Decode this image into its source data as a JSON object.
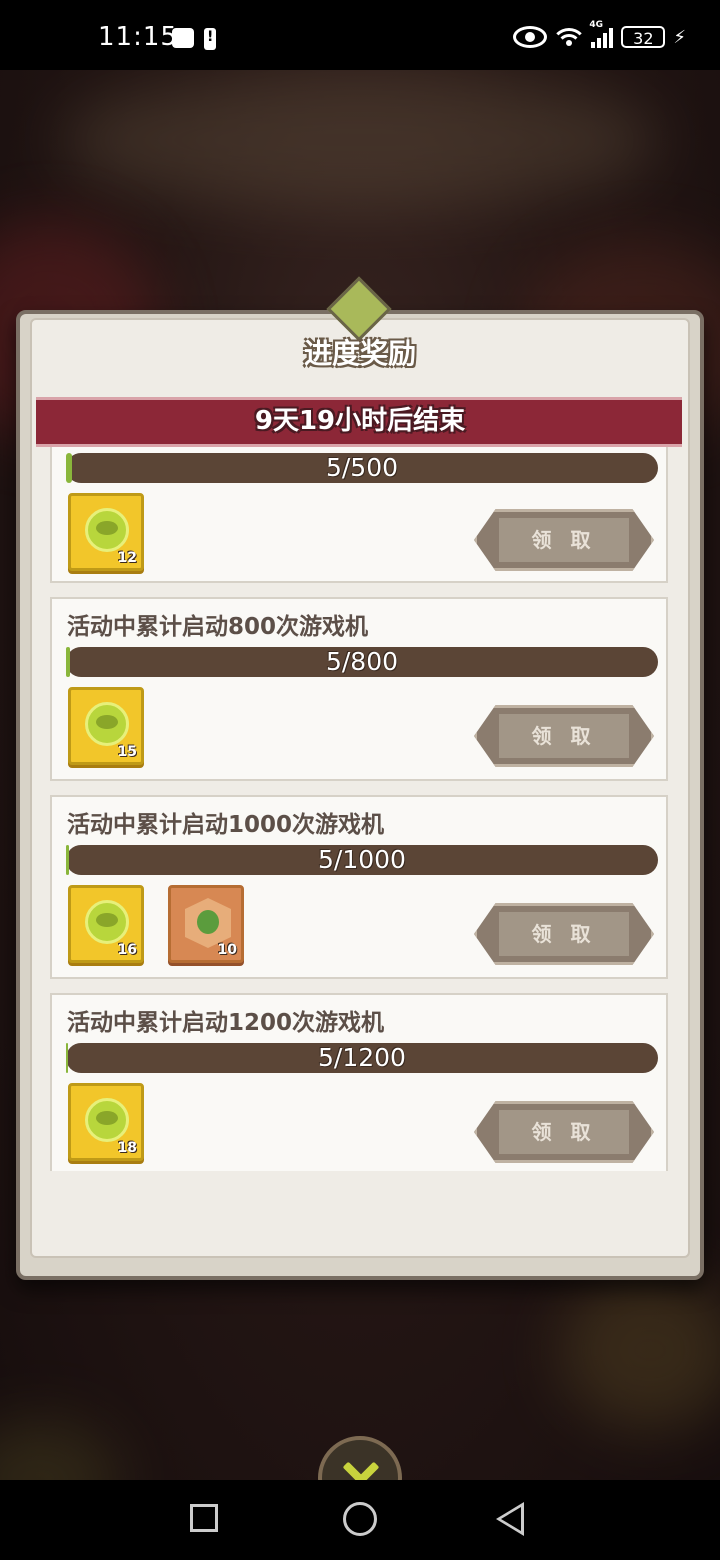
{
  "status_bar": {
    "time": "11:15",
    "network": "4G",
    "battery": "32"
  },
  "panel": {
    "title": "进度奖励",
    "countdown": "9天19小时后结束",
    "claim_label": "领 取"
  },
  "tasks": [
    {
      "title": "",
      "progress_text": "5/500",
      "progress_fraction": 0.01,
      "rewards": [
        {
          "icon": "coin-icon",
          "count": "12"
        }
      ]
    },
    {
      "title": "活动中累计启动800次游戏机",
      "progress_text": "5/800",
      "progress_fraction": 0.00625,
      "rewards": [
        {
          "icon": "coin-icon",
          "count": "15"
        }
      ]
    },
    {
      "title": "活动中累计启动1000次游戏机",
      "progress_text": "5/1000",
      "progress_fraction": 0.005,
      "rewards": [
        {
          "icon": "coin-icon",
          "count": "16"
        },
        {
          "icon": "frog-badge-icon",
          "count": "10"
        }
      ]
    },
    {
      "title": "活动中累计启动1200次游戏机",
      "progress_text": "5/1200",
      "progress_fraction": 0.0042,
      "rewards": [
        {
          "icon": "coin-icon",
          "count": "18"
        }
      ]
    }
  ]
}
